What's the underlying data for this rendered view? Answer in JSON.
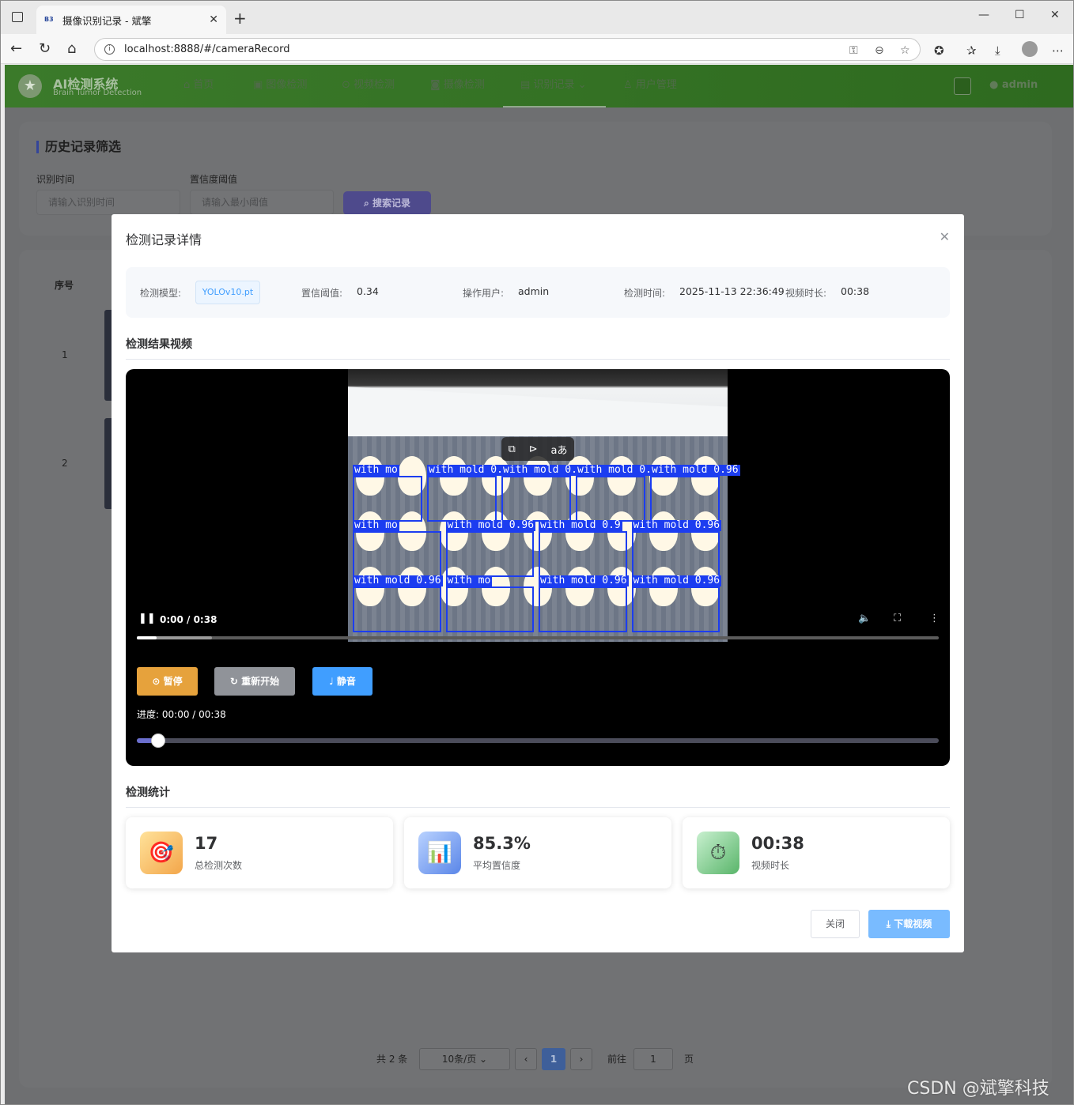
{
  "browser": {
    "tab_title": "摄像识别记录 - 斌擎",
    "favicon": "B3",
    "url": "localhost:8888/#/cameraRecord"
  },
  "app": {
    "logo_title": "AI检测系统",
    "logo_subtitle": "Brain Tumor Detection",
    "nav": [
      {
        "label": "首页",
        "icon": "home-icon"
      },
      {
        "label": "图像检测",
        "icon": "image-icon"
      },
      {
        "label": "视频检测",
        "icon": "play-circle-icon"
      },
      {
        "label": "摄像检测",
        "icon": "camera-icon"
      },
      {
        "label": "识别记录",
        "icon": "document-icon",
        "active": true
      },
      {
        "label": "用户管理",
        "icon": "user-icon"
      }
    ],
    "user": "admin"
  },
  "filter": {
    "title": "历史记录筛选",
    "time_label": "识别时间",
    "time_placeholder": "请输入识别时间",
    "conf_label": "置信度阈值",
    "conf_placeholder": "请输入最小阈值",
    "search_button": "搜索记录"
  },
  "table": {
    "col_index": "序号",
    "rows": [
      "1",
      "2"
    ]
  },
  "pagination": {
    "total": "共 2 条",
    "page_size": "10条/页",
    "current": "1",
    "goto_label": "前往",
    "goto_value": "1",
    "page_suffix": "页"
  },
  "modal": {
    "title": "检测记录详情",
    "info": {
      "model_label": "检测模型:",
      "model_value": "YOLOv10.pt",
      "conf_label": "置信阈值:",
      "conf_value": "0.34",
      "user_label": "操作用户:",
      "user_value": "admin",
      "time_label": "检测时间:",
      "time_value": "2025-11-13 22:36:49",
      "duration_label": "视频时长:",
      "duration_value": "00:38"
    },
    "video_section": "检测结果视频",
    "video": {
      "time_display": "0:00 / 0:38",
      "played_fraction": 0.025,
      "buffered_fraction": 0.094,
      "detection_labels": [
        "with mo",
        "with mold 0.96",
        "with mold 0.96",
        "with mold 0.95",
        "with mold 0.96",
        "with mo",
        "with mold 0.96",
        "with mold 0.9",
        "with mold 0.96",
        "with mold 0.96",
        "with mo",
        "with mold 0.96",
        "with mold 0.96"
      ]
    },
    "controls": {
      "pause": "暂停",
      "restart": "重新开始",
      "mute": "静音",
      "progress_label": "进度:",
      "progress_value": "00:00 / 00:38",
      "slider_fraction": 0.02
    },
    "stats_section": "检测统计",
    "stats": [
      {
        "value": "17",
        "label": "总检测次数",
        "icon": "target-icon"
      },
      {
        "value": "85.3%",
        "label": "平均置信度",
        "icon": "bar-chart-icon"
      },
      {
        "value": "00:38",
        "label": "视频时长",
        "icon": "stopwatch-icon"
      }
    ],
    "close_button": "关闭",
    "download_button": "下载视频"
  },
  "watermark": "CSDN @斌擎科技",
  "colors": {
    "nav_green": "#2e6a1f",
    "pause_btn": "#e6a23c",
    "restart_btn": "#909399",
    "mute_btn": "#409eff",
    "download_btn": "#79bbff",
    "detection_box": "#1c3df0"
  }
}
